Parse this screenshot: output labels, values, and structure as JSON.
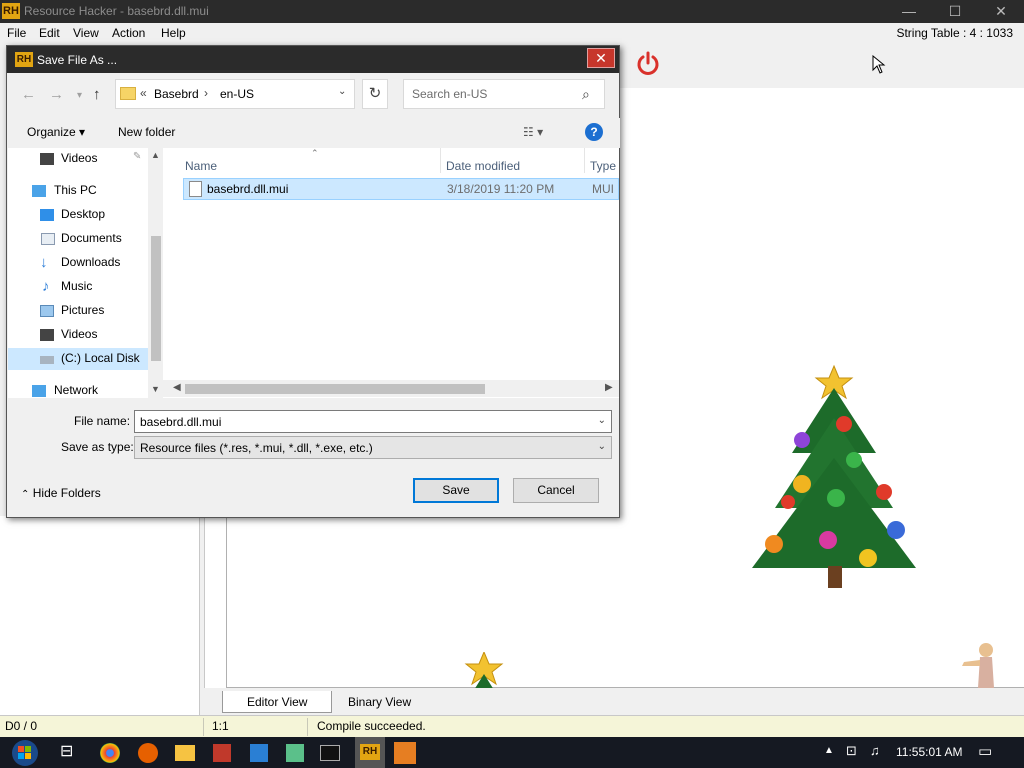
{
  "app": {
    "title": "Resource Hacker - basebrd.dll.mui",
    "icon_text": "RH",
    "window_controls": {
      "minimize": "—",
      "maximize": "☐",
      "close": "✕"
    }
  },
  "menu": [
    "File",
    "Edit",
    "View",
    "Action",
    "Help"
  ],
  "string_table_label": "String Table : 4 : 1033",
  "editor_tabs": [
    "Editor View",
    "Binary View"
  ],
  "status": {
    "left": "D0 / 0",
    "position": "1:1",
    "message": "Compile succeeded."
  },
  "dialog": {
    "title": "Save File As ...",
    "close": "✕",
    "address": {
      "prefix": "«",
      "crumbs": [
        "Basebrd",
        "en-US"
      ],
      "separator": "›"
    },
    "search_placeholder": "Search en-US",
    "organize": "Organize",
    "new_folder": "New folder",
    "nav_items": [
      {
        "label": "Videos",
        "icon": "videos-icon"
      },
      {
        "label": "This PC",
        "icon": "pc-icon"
      },
      {
        "label": "Desktop",
        "icon": "desktop-icon"
      },
      {
        "label": "Documents",
        "icon": "documents-icon"
      },
      {
        "label": "Downloads",
        "icon": "downloads-icon"
      },
      {
        "label": "Music",
        "icon": "music-icon"
      },
      {
        "label": "Pictures",
        "icon": "pictures-icon"
      },
      {
        "label": "Videos",
        "icon": "videos-icon"
      },
      {
        "label": "(C:) Local Disk",
        "icon": "disk-icon"
      },
      {
        "label": "Network",
        "icon": "network-icon"
      }
    ],
    "columns": [
      "Name",
      "Date modified",
      "Type"
    ],
    "files": [
      {
        "name": "basebrd.dll.mui",
        "date": "3/18/2019 11:20 PM",
        "type": "MUI"
      }
    ],
    "file_name_label": "File name:",
    "file_name": "basebrd.dll.mui",
    "save_type_label": "Save as type:",
    "save_type": "Resource files (*.res, *.mui, *.dll, *.exe, etc.)",
    "hide_folders": "Hide Folders",
    "save": "Save",
    "cancel": "Cancel"
  },
  "taskbar": {
    "clock": "11:55:01 AM"
  },
  "colors": {
    "accent": "#0078d7",
    "power": "#d9312b",
    "selection": "#cce8ff"
  }
}
